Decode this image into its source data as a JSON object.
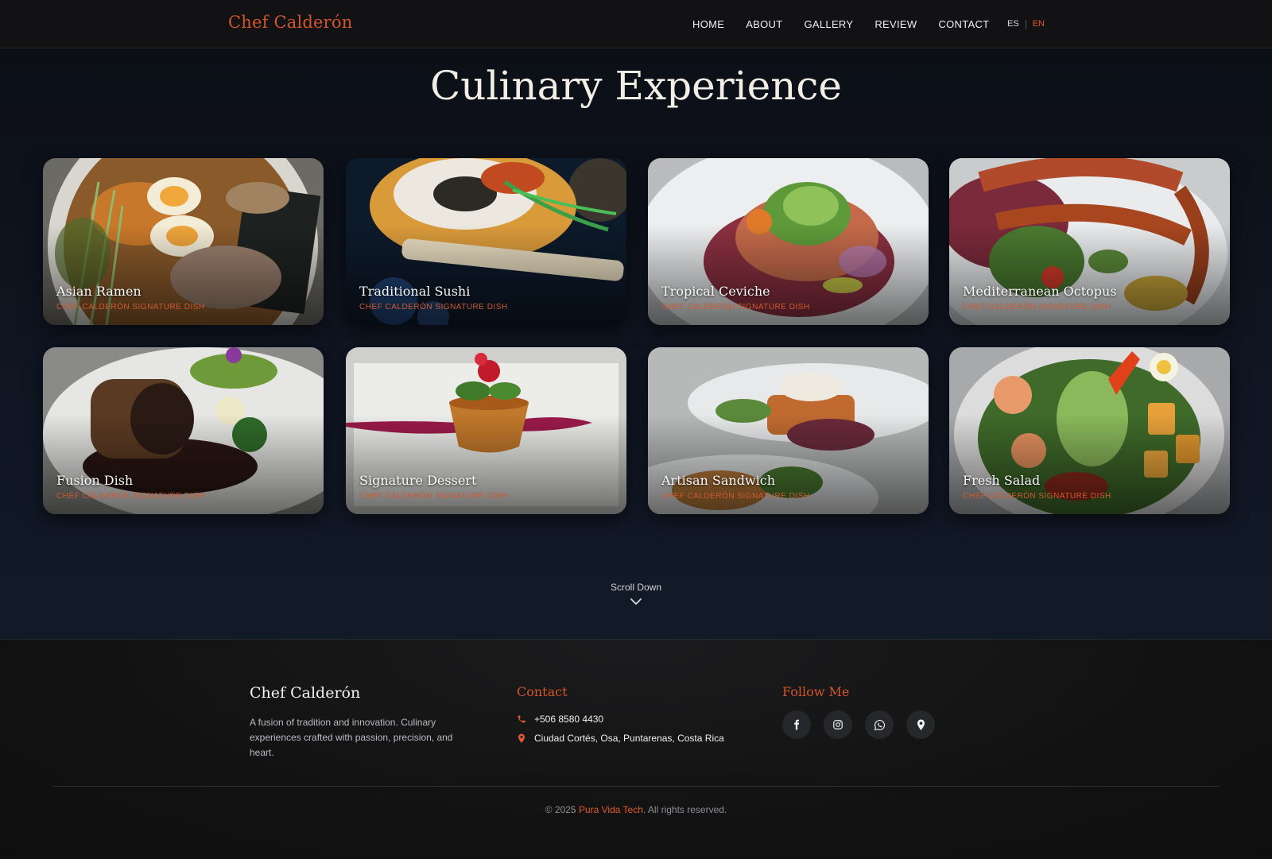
{
  "nav": {
    "brand": "Chef Calderón",
    "links": [
      "HOME",
      "ABOUT",
      "GALLERY",
      "REVIEW",
      "CONTACT"
    ],
    "lang_es": "ES",
    "lang_en": "EN"
  },
  "gallery": {
    "title": "Culinary Experience",
    "dishes": [
      {
        "title": "Asian Ramen",
        "subtitle": "CHEF CALDERÓN SIGNATURE DISH"
      },
      {
        "title": "Traditional Sushi",
        "subtitle": "CHEF CALDERÓN SIGNATURE DISH"
      },
      {
        "title": "Tropical Ceviche",
        "subtitle": "CHEF CALDERÓN SIGNATURE DISH"
      },
      {
        "title": "Mediterranean Octopus",
        "subtitle": "CHEF CALDERÓN SIGNATURE DISH"
      },
      {
        "title": "Fusion Dish",
        "subtitle": "CHEF CALDERÓN SIGNATURE DISH"
      },
      {
        "title": "Signature Dessert",
        "subtitle": "CHEF CALDERÓN SIGNATURE DISH"
      },
      {
        "title": "Artisan Sandwich",
        "subtitle": "CHEF CALDERÓN SIGNATURE DISH"
      },
      {
        "title": "Fresh Salad",
        "subtitle": "CHEF CALDERÓN SIGNATURE DISH"
      }
    ],
    "scroll_label": "Scroll Down"
  },
  "footer": {
    "brand": "Chef Calderón",
    "description": "A fusion of tradition and innovation. Culinary experiences crafted with passion, precision, and heart.",
    "contact_title": "Contact",
    "phone": "+506 8580 4430",
    "address": "Ciudad Cortés, Osa, Puntarenas, Costa Rica",
    "follow_title": "Follow Me",
    "socials": [
      "facebook-icon",
      "instagram-icon",
      "whatsapp-icon",
      "location-icon"
    ],
    "copyright_prefix": "© 2025 ",
    "copyright_brand": "Pura Vida Tech",
    "copyright_suffix": ". All rights reserved."
  },
  "colors": {
    "accent": "#d2552c",
    "background": "#0d1018",
    "footer_bg": "#121212"
  }
}
